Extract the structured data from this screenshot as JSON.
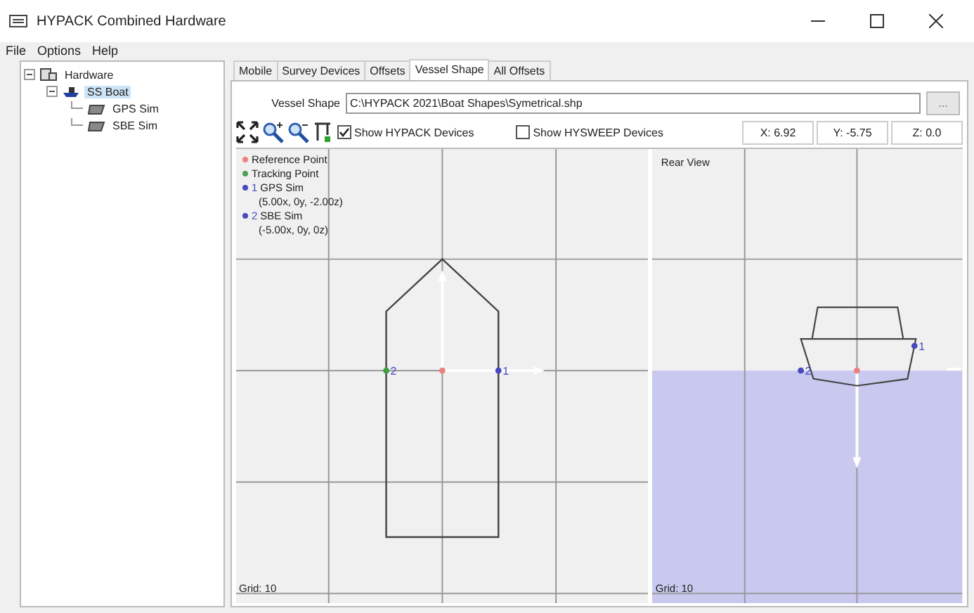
{
  "window": {
    "title": "HYPACK Combined Hardware"
  },
  "menu": [
    "File",
    "Options",
    "Help"
  ],
  "tree": [
    {
      "label": "Hardware",
      "kind": "root",
      "expanded": true,
      "selected": false,
      "children": [
        {
          "label": "SS Boat",
          "kind": "boat",
          "expanded": true,
          "selected": true,
          "children": [
            {
              "label": "GPS Sim",
              "kind": "device",
              "selected": false
            },
            {
              "label": "SBE Sim",
              "kind": "device",
              "selected": false
            }
          ]
        }
      ]
    }
  ],
  "tabs": [
    {
      "label": "Mobile",
      "selected": false
    },
    {
      "label": "Survey Devices",
      "selected": false
    },
    {
      "label": "Offsets",
      "selected": false
    },
    {
      "label": "Vessel Shape",
      "selected": true
    },
    {
      "label": "All Offsets",
      "selected": false
    }
  ],
  "vessel_shape": {
    "label": "Vessel Shape",
    "value": "C:\\HYPACK 2021\\Boat Shapes\\Symetrical.shp",
    "browse": "..."
  },
  "toolbar": {
    "checkboxes": [
      {
        "label": "Show HYPACK Devices",
        "checked": true
      },
      {
        "label": "Show HYSWEEP Devices",
        "checked": false
      }
    ],
    "coords": [
      "X: 6.92",
      "Y: -5.75",
      "Z: 0.0"
    ]
  },
  "legend": [
    {
      "kind": "point",
      "label": "Reference Point",
      "color": "#f08080"
    },
    {
      "kind": "point",
      "label": "Tracking Point",
      "color": "#50a050"
    },
    {
      "kind": "device",
      "number": "1",
      "label": "GPS Sim",
      "coords": "(5.00x, 0y, -2.00z)",
      "color": "#4848c0"
    },
    {
      "kind": "device",
      "number": "2",
      "label": "SBE Sim",
      "coords": "(-5.00x, 0y, 0z)",
      "color": "#4848c0"
    }
  ],
  "views": [
    {
      "kind": "top",
      "grid": "Grid: 10",
      "markers": [
        {
          "label": "2",
          "color": "#40a040"
        },
        {
          "label": "1",
          "color": "#4848c0"
        }
      ]
    },
    {
      "kind": "rear",
      "title": "Rear View",
      "grid": "Grid: 10",
      "markers": [
        {
          "label": "2",
          "color": "#4848c0"
        },
        {
          "label": "1",
          "color": "#4848c0"
        }
      ]
    }
  ]
}
